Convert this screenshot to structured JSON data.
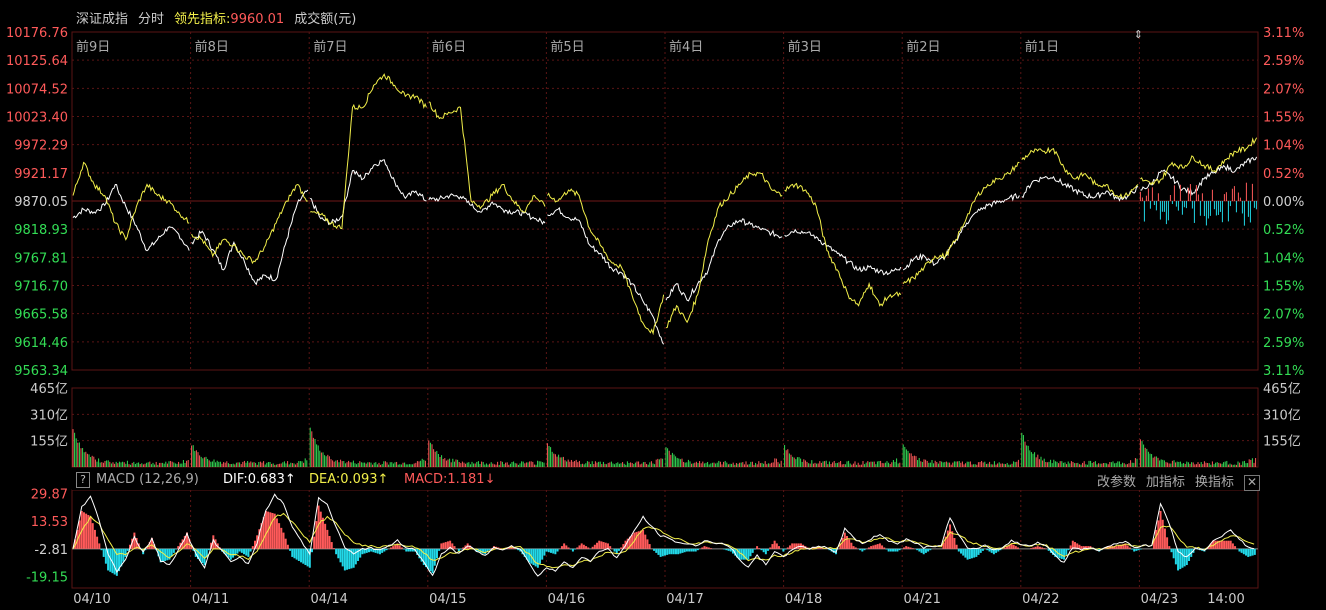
{
  "header": {
    "index_name": "深证成指",
    "mode": "分时",
    "leading_label": "领先指标:",
    "leading_value": "9960.01",
    "volume_label": "成交额(元)"
  },
  "colors": {
    "up": "#ff5a5a",
    "down": "#33dd55",
    "flat": "#d0d0d0",
    "price_line": "#ffffff",
    "leading_line": "#f2ef4a",
    "grid": "#5a1414",
    "macd_down": "#22d8e8",
    "text_gray": "#cccccc"
  },
  "chart_data": [
    {
      "type": "line",
      "title": "",
      "day_labels": [
        "前9日",
        "前8日",
        "前7日",
        "前6日",
        "前5日",
        "前4日",
        "前3日",
        "前2日",
        "前1日"
      ],
      "y_left_ticks": [
        "10176.76",
        "10125.64",
        "10074.52",
        "10023.40",
        "9972.29",
        "9921.17",
        "9870.05",
        "9818.93",
        "9767.81",
        "9716.70",
        "9665.58",
        "9614.46",
        "9563.34"
      ],
      "y_right_ticks": [
        "3.11%",
        "2.59%",
        "2.07%",
        "1.55%",
        "1.04%",
        "0.52%",
        "0.00%",
        "0.52%",
        "1.04%",
        "1.55%",
        "2.07%",
        "2.59%",
        "3.11%"
      ],
      "ylim": [
        9563.34,
        10176.76
      ],
      "base": 9870.05,
      "series": [
        {
          "values": [
            9840,
            9855,
            9850,
            9862,
            9900,
            9860,
            9825,
            9780,
            9800,
            9822,
            9810,
            9780,
            9795,
            9815,
            9782,
            9745,
            9795,
            9760,
            9722,
            9735,
            9728,
            9800,
            9865,
            9890,
            9875,
            9838,
            9830,
            9842,
            9925,
            9910,
            9935,
            9945,
            9905,
            9875,
            9888,
            9870,
            9872,
            9874,
            9880,
            9878,
            9862,
            9850,
            9868,
            9855,
            9850,
            9848,
            9838,
            9830,
            9845,
            9855,
            9840,
            9835,
            9790,
            9775,
            9750,
            9740,
            9720,
            9690,
            9660,
            9610,
            9690,
            9720,
            9690,
            9720,
            9745,
            9800,
            9825,
            9835,
            9828,
            9818,
            9812,
            9805,
            9808,
            9818,
            9812,
            9805,
            9788,
            9775,
            9760,
            9745,
            9750,
            9742,
            9740,
            9750,
            9745,
            9765,
            9770,
            9755,
            9770,
            9800,
            9830,
            9850,
            9862,
            9868,
            9875,
            9880,
            9878,
            9905,
            9912,
            9914,
            9900,
            9890,
            9880,
            9878,
            9888,
            9875,
            9878,
            9895,
            9890,
            9900,
            9925,
            9912,
            9892,
            9885,
            9910,
            9922,
            9932,
            9925,
            9940,
            9950,
            9965,
            9950,
            9944,
            9942
          ]
        },
        {
          "values": [
            9880,
            9940,
            9900,
            9880,
            9830,
            9800,
            9860,
            9900,
            9880,
            9870,
            9850,
            9830,
            9810,
            9800,
            9770,
            9800,
            9790,
            9770,
            9760,
            9790,
            9830,
            9870,
            9900,
            9870,
            9850,
            9845,
            9830,
            9820,
            10040,
            10040,
            10080,
            10100,
            10080,
            10060,
            10060,
            10040,
            10050,
            10020,
            10030,
            10040,
            9870,
            9860,
            9880,
            9900,
            9870,
            9850,
            9880,
            9860,
            9880,
            9870,
            9890,
            9880,
            9820,
            9790,
            9760,
            9750,
            9700,
            9650,
            9630,
            9700,
            9640,
            9680,
            9650,
            9700,
            9800,
            9860,
            9880,
            9900,
            9920,
            9920,
            9890,
            9880,
            9890,
            9900,
            9890,
            9860,
            9780,
            9745,
            9700,
            9680,
            9720,
            9680,
            9700,
            9700,
            9720,
            9730,
            9750,
            9770,
            9770,
            9800,
            9840,
            9880,
            9900,
            9910,
            9920,
            9940,
            9945,
            9960,
            9960,
            9965,
            9930,
            9910,
            9920,
            9900,
            9900,
            9880,
            9880,
            9900,
            9910,
            9900,
            9910,
            9940,
            9930,
            9950,
            9935,
            9925,
            9945,
            9960,
            9965,
            9985,
            10000,
            9980,
            9975,
            9965
          ]
        }
      ]
    },
    {
      "type": "bar",
      "title": "",
      "ylabel": "成交额(元)",
      "y_ticks": [
        "465亿",
        "310亿",
        "155亿"
      ],
      "ylim": [
        0,
        465
      ],
      "open_spikes": [
        210,
        110,
        210,
        140,
        120,
        90,
        100,
        120,
        185,
        150
      ],
      "base_level": 40
    },
    {
      "type": "line",
      "title": "MACD (12,26,9)",
      "indicator": "MACD (12,26,9)",
      "dif": "DIF:0.683↑",
      "dea": "DEA:0.093↑",
      "macd": "MACD:1.181↓",
      "y_ticks": [
        "29.87",
        "13.53",
        "-2.81",
        "-19.15"
      ],
      "ylim": [
        -26,
        32
      ],
      "zero": -2.81,
      "tools": [
        "改参数",
        "加指标",
        "换指标"
      ],
      "close": "✕",
      "help": "?",
      "dif_values": [
        -3,
        22,
        28,
        14,
        -6,
        -16,
        -9,
        4,
        -5,
        3,
        -10,
        -12,
        -4,
        6,
        -6,
        -14,
        2,
        -4,
        -10,
        -8,
        -12,
        1,
        20,
        29,
        24,
        10,
        2,
        -6,
        28,
        23,
        10,
        -2,
        -6,
        -3,
        -2,
        -4,
        -1,
        2,
        -2,
        -3,
        -11,
        -19,
        -6,
        -2,
        -6,
        -1,
        -4,
        -7,
        -2,
        -3,
        -1,
        -3,
        -11,
        -19,
        -14,
        -16,
        -10,
        -14,
        -8,
        -10,
        -4,
        -3,
        -8,
        -1,
        8,
        16,
        10,
        5,
        3,
        1,
        0,
        -1,
        2,
        1,
        0,
        -2,
        -9,
        -14,
        -7,
        -12,
        -4,
        -8,
        -3,
        -1,
        -3,
        -1,
        -2,
        -5,
        9,
        4,
        0,
        3,
        6,
        2,
        0,
        3,
        1,
        -2,
        -1,
        -1,
        16,
        5,
        -2,
        -3,
        -1,
        -4,
        -2,
        2,
        0,
        -1,
        1,
        -1,
        -7,
        -11,
        -2,
        -3,
        -2,
        -4,
        -1,
        0,
        2,
        -2,
        -1,
        -1,
        24,
        12,
        -4,
        -8,
        -2,
        -4,
        2,
        5,
        8,
        3,
        -2,
        -3
      ],
      "dea_values": [
        -3,
        8,
        16,
        12,
        2,
        -6,
        -6,
        -2,
        -3,
        -1,
        -5,
        -8,
        -5,
        0,
        -3,
        -8,
        -3,
        -3,
        -6,
        -7,
        -9,
        -4,
        6,
        16,
        18,
        13,
        7,
        1,
        12,
        16,
        12,
        6,
        1,
        -1,
        -1,
        -2,
        -1,
        0,
        -1,
        -2,
        -5,
        -10,
        -8,
        -5,
        -5,
        -3,
        -3,
        -5,
        -3,
        -3,
        -2,
        -2,
        -6,
        -12,
        -13,
        -14,
        -12,
        -13,
        -10,
        -10,
        -7,
        -5,
        -6,
        -4,
        2,
        9,
        10,
        8,
        5,
        3,
        1,
        0,
        1,
        1,
        0,
        -1,
        -5,
        -10,
        -8,
        -10,
        -7,
        -7,
        -5,
        -3,
        -3,
        -2,
        -2,
        -3,
        3,
        3,
        1,
        2,
        4,
        3,
        1,
        2,
        1,
        0,
        -1,
        -1,
        7,
        6,
        2,
        0,
        -1,
        -2,
        -2,
        0,
        0,
        -1,
        0,
        -1,
        -4,
        -7,
        -5,
        -4,
        -3,
        -3,
        -2,
        -1,
        0,
        -1,
        -1,
        -1,
        10,
        11,
        4,
        -2,
        -2,
        -3,
        -1,
        2,
        5,
        4,
        1,
        -1
      ]
    }
  ],
  "x_labels": [
    "04/10",
    "04/11",
    "04/14",
    "04/15",
    "04/16",
    "04/17",
    "04/18",
    "04/21",
    "04/22",
    "04/23",
    "14:00"
  ]
}
